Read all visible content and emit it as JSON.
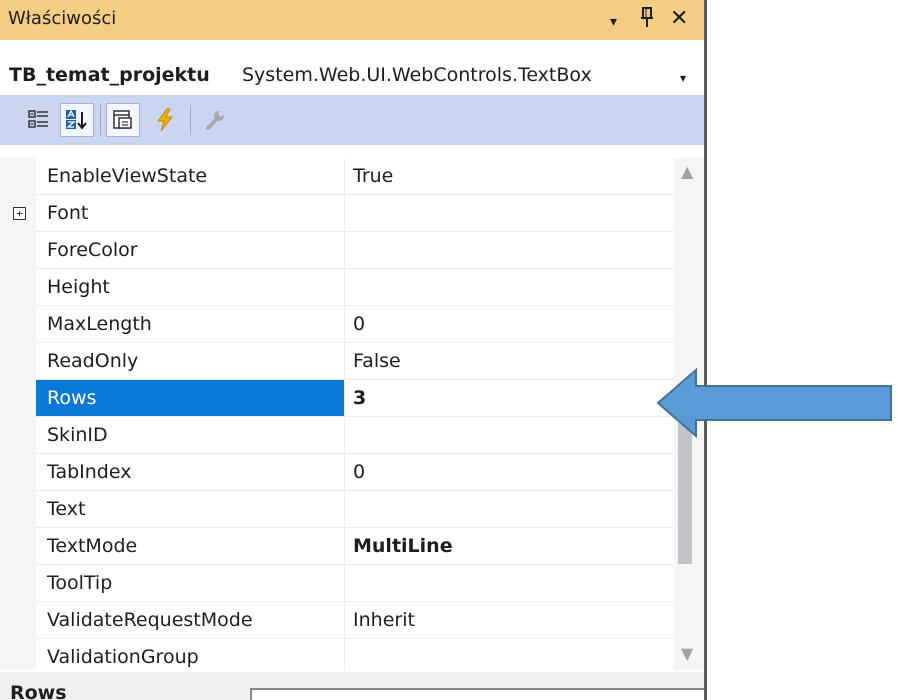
{
  "panel": {
    "title": "Właściwości",
    "controls": {
      "dropdown": "▾",
      "pin": "ᵽ",
      "close": "✕"
    }
  },
  "object": {
    "name": "TB_temat_projektu",
    "type": "System.Web.UI.WebControls.TextBox",
    "dropdown": "▾"
  },
  "toolbar": {
    "tools": [
      {
        "icon": "categorized-icon",
        "checked": false
      },
      {
        "icon": "alphabetical-icon",
        "checked": true
      },
      {
        "icon": "properties-icon",
        "checked": true
      },
      {
        "icon": "events-icon",
        "checked": false
      },
      {
        "icon": "property-pages-icon",
        "checked": false
      }
    ]
  },
  "grid": {
    "rows": [
      {
        "name": "EnableViewState",
        "value": "True"
      },
      {
        "name": "Font",
        "value": "",
        "expandable": true,
        "expander": "+"
      },
      {
        "name": "ForeColor",
        "value": ""
      },
      {
        "name": "Height",
        "value": ""
      },
      {
        "name": "MaxLength",
        "value": "0"
      },
      {
        "name": "ReadOnly",
        "value": "False"
      },
      {
        "name": "Rows",
        "value": "3",
        "selected": true,
        "bold": true
      },
      {
        "name": "SkinID",
        "value": ""
      },
      {
        "name": "TabIndex",
        "value": "0"
      },
      {
        "name": "Text",
        "value": ""
      },
      {
        "name": "TextMode",
        "value": "MultiLine",
        "bold": true
      },
      {
        "name": "ToolTip",
        "value": ""
      },
      {
        "name": "ValidateRequestMode",
        "value": "Inherit"
      },
      {
        "name": "ValidationGroup",
        "value": ""
      }
    ]
  },
  "scrollbar": {
    "up": "▲",
    "down": "▼"
  },
  "description": {
    "title": "Rows"
  },
  "colors": {
    "titlebar": "#f5cc84",
    "toolbar": "#ccd5f0",
    "selection": "#0a78d7",
    "arrow": "#5b9bd5",
    "arrow_border": "#41719c"
  }
}
